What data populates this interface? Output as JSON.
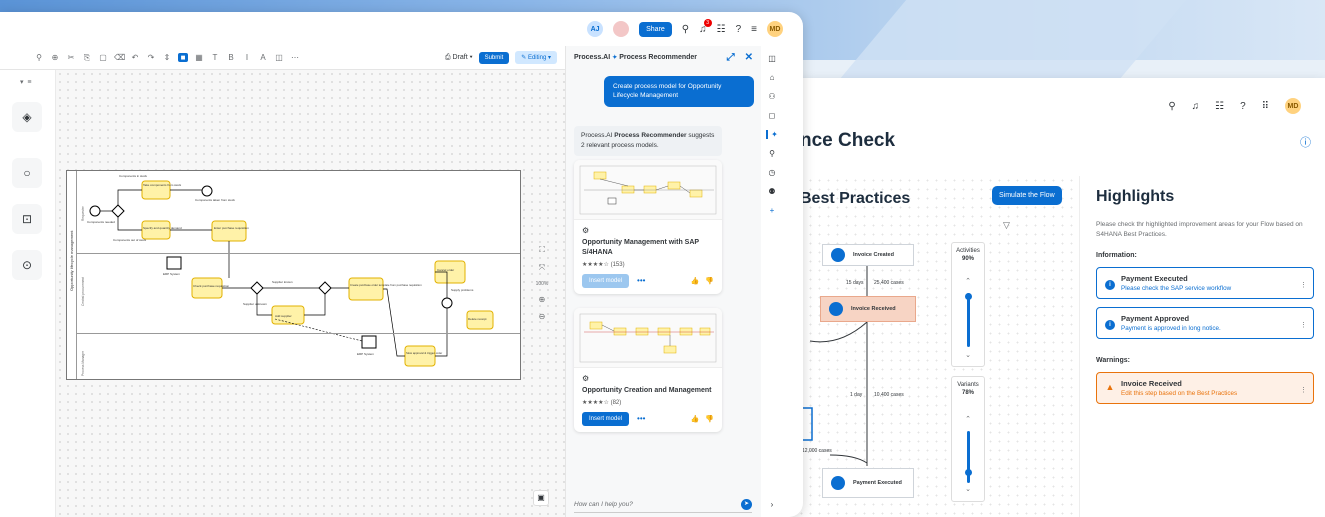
{
  "right_window": {
    "title": "nce Check",
    "user_initials": "MD",
    "best_practices": {
      "heading": "Best Practices",
      "simulate_button": "Simulate the Flow",
      "nodes": [
        "Invoice Created",
        "Invoice Received",
        "Payment Executed"
      ],
      "edge_labels": [
        "15 days",
        "25,400 cases",
        "1 day",
        "10,400 cases",
        "12,000 cases"
      ],
      "activities": {
        "label": "Activities",
        "percent": "90%",
        "value": 0.9
      },
      "variants": {
        "label": "Variants",
        "percent": "78%",
        "value": 0.78
      }
    },
    "highlights": {
      "heading": "Highlights",
      "description": "Please check thr highlighted improvement areas for your Flow based on S4HANA Best Practices.",
      "information_label": "Information:",
      "info_items": [
        {
          "title": "Payment Executed",
          "subtitle": "Please check the SAP service workflow"
        },
        {
          "title": "Payment Approved",
          "subtitle": "Payment is approved in long notice."
        }
      ],
      "warnings_label": "Warnings:",
      "warning_items": [
        {
          "title": "Invoice Received",
          "subtitle": "Edit this step based on the Best Practices"
        }
      ]
    }
  },
  "left_window": {
    "shell": {
      "user_a": "AJ",
      "share_label": "Share",
      "notif_count": "3",
      "user_initials": "MD"
    },
    "toolbar": {
      "draft_label": "Draft",
      "submit_label": "Submit",
      "editing_label": "Editing"
    },
    "diagram": {
      "lanes": [
        "Requester",
        "Central procurement",
        "Process Manager"
      ],
      "pool_label": "Opportunity lifecycle management",
      "labels": {
        "components_in_stock": "Components in stock",
        "take_components": "Take components from stock",
        "components_taken": "Components taken from stock",
        "components_needed": "Components needed",
        "components_out": "Components out of stock",
        "specify_quantity": "Specify and quantity demand",
        "enter_requisition": "Enter purchase requisition",
        "erp_system": "ERP System",
        "check_requisition": "Check purchase requisition",
        "supplier_known": "Supplier known",
        "supplier_unknown": "Supplier unknown",
        "add_supplier": "Add supplier",
        "create_order": "Create purchase order template from purchase requisition",
        "erp_system2": "ERP System",
        "slow_approval": "Slow approval & trigger order",
        "supply_problems": "Supply problems",
        "delete_receipt": "Delete receipt",
        "cancel_order": "Cancel order",
        "requester_lane": "Requester",
        "central_lane": "Central procurement",
        "process_lane": "Process Manager"
      }
    },
    "zoom": {
      "percent": "100%"
    },
    "assistant": {
      "title_prefix": "Process.AI",
      "title_rest": "Process Recommender",
      "user_prompt": "Create process model for Opportunity Lifecycle Management",
      "reply_prefix": "Process.AI",
      "reply_bold": "Process Recommender",
      "reply_rest": "suggests 2 relevant process models.",
      "cards": [
        {
          "title": "Opportunity Management with SAP S/4HANA",
          "stars": "★★★★☆",
          "count": "(153)",
          "insert": "Insert model",
          "rating": 4
        },
        {
          "title": "Opportunity Creation and Management",
          "stars": "★★★★☆",
          "count": "(82)",
          "insert": "Insert model",
          "rating": 4
        }
      ],
      "ask_placeholder": "How can I help you?"
    }
  }
}
